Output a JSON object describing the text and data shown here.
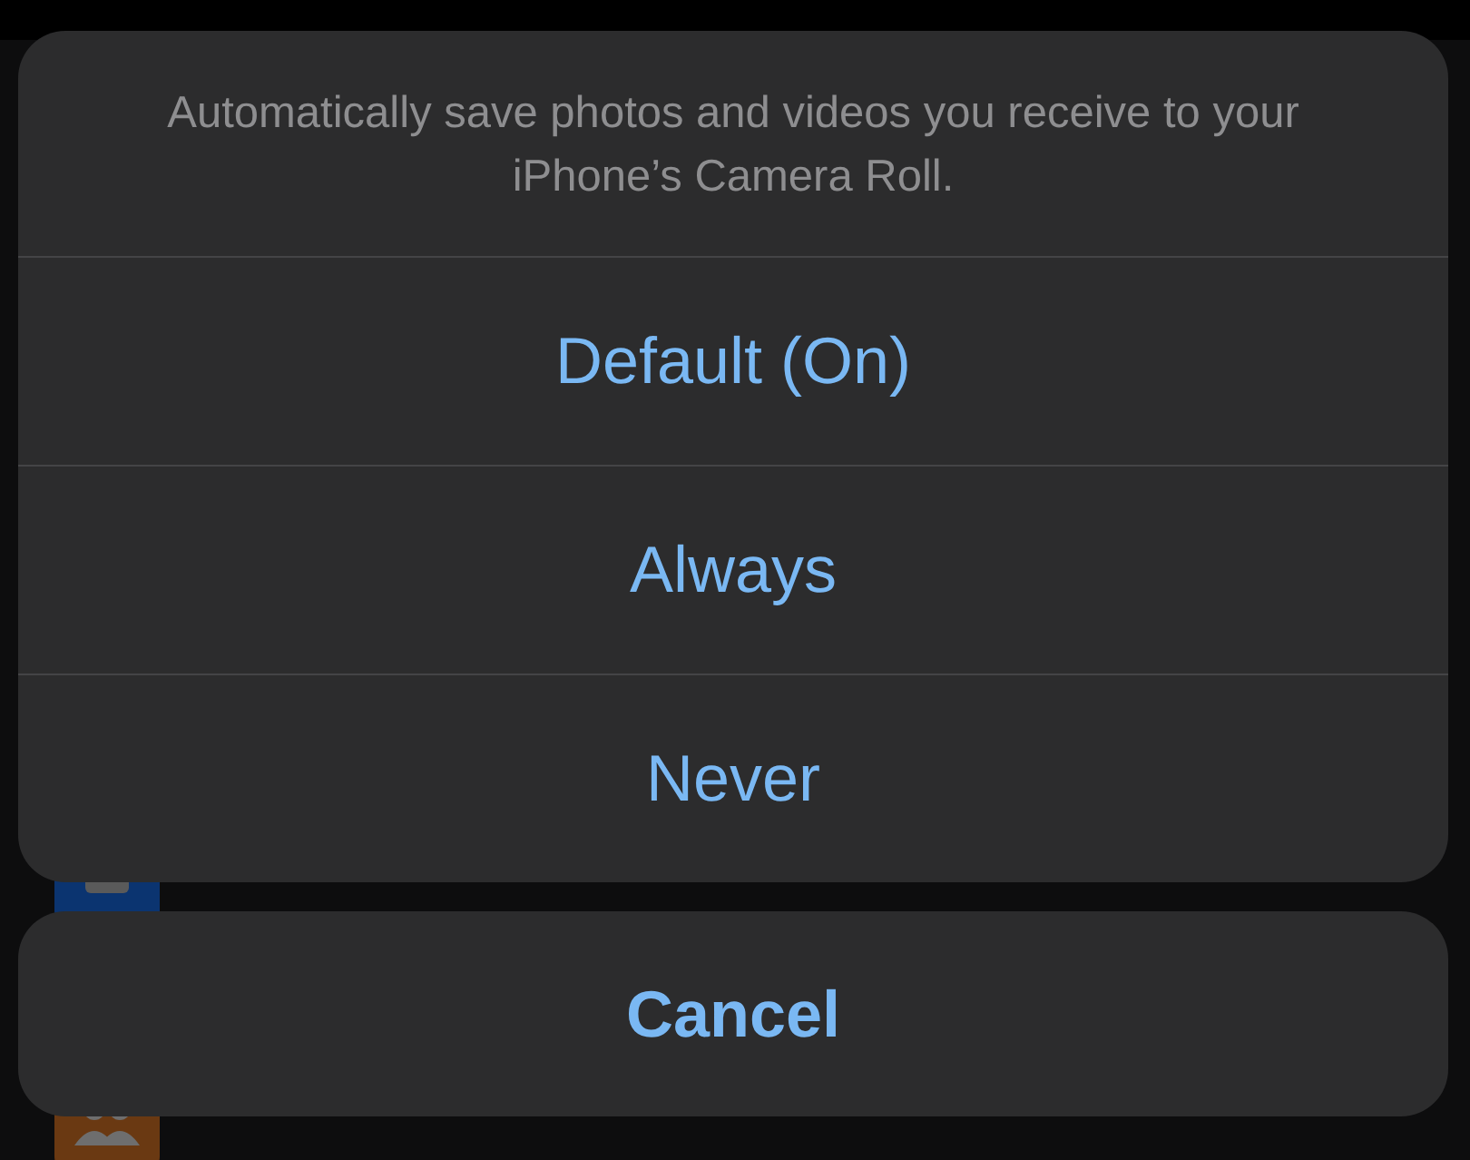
{
  "action_sheet": {
    "message": "Automatically save photos and videos you receive to your iPhone’s Camera Roll.",
    "options": [
      {
        "label": "Default (On)"
      },
      {
        "label": "Always"
      },
      {
        "label": "Never"
      }
    ],
    "cancel": "Cancel"
  }
}
